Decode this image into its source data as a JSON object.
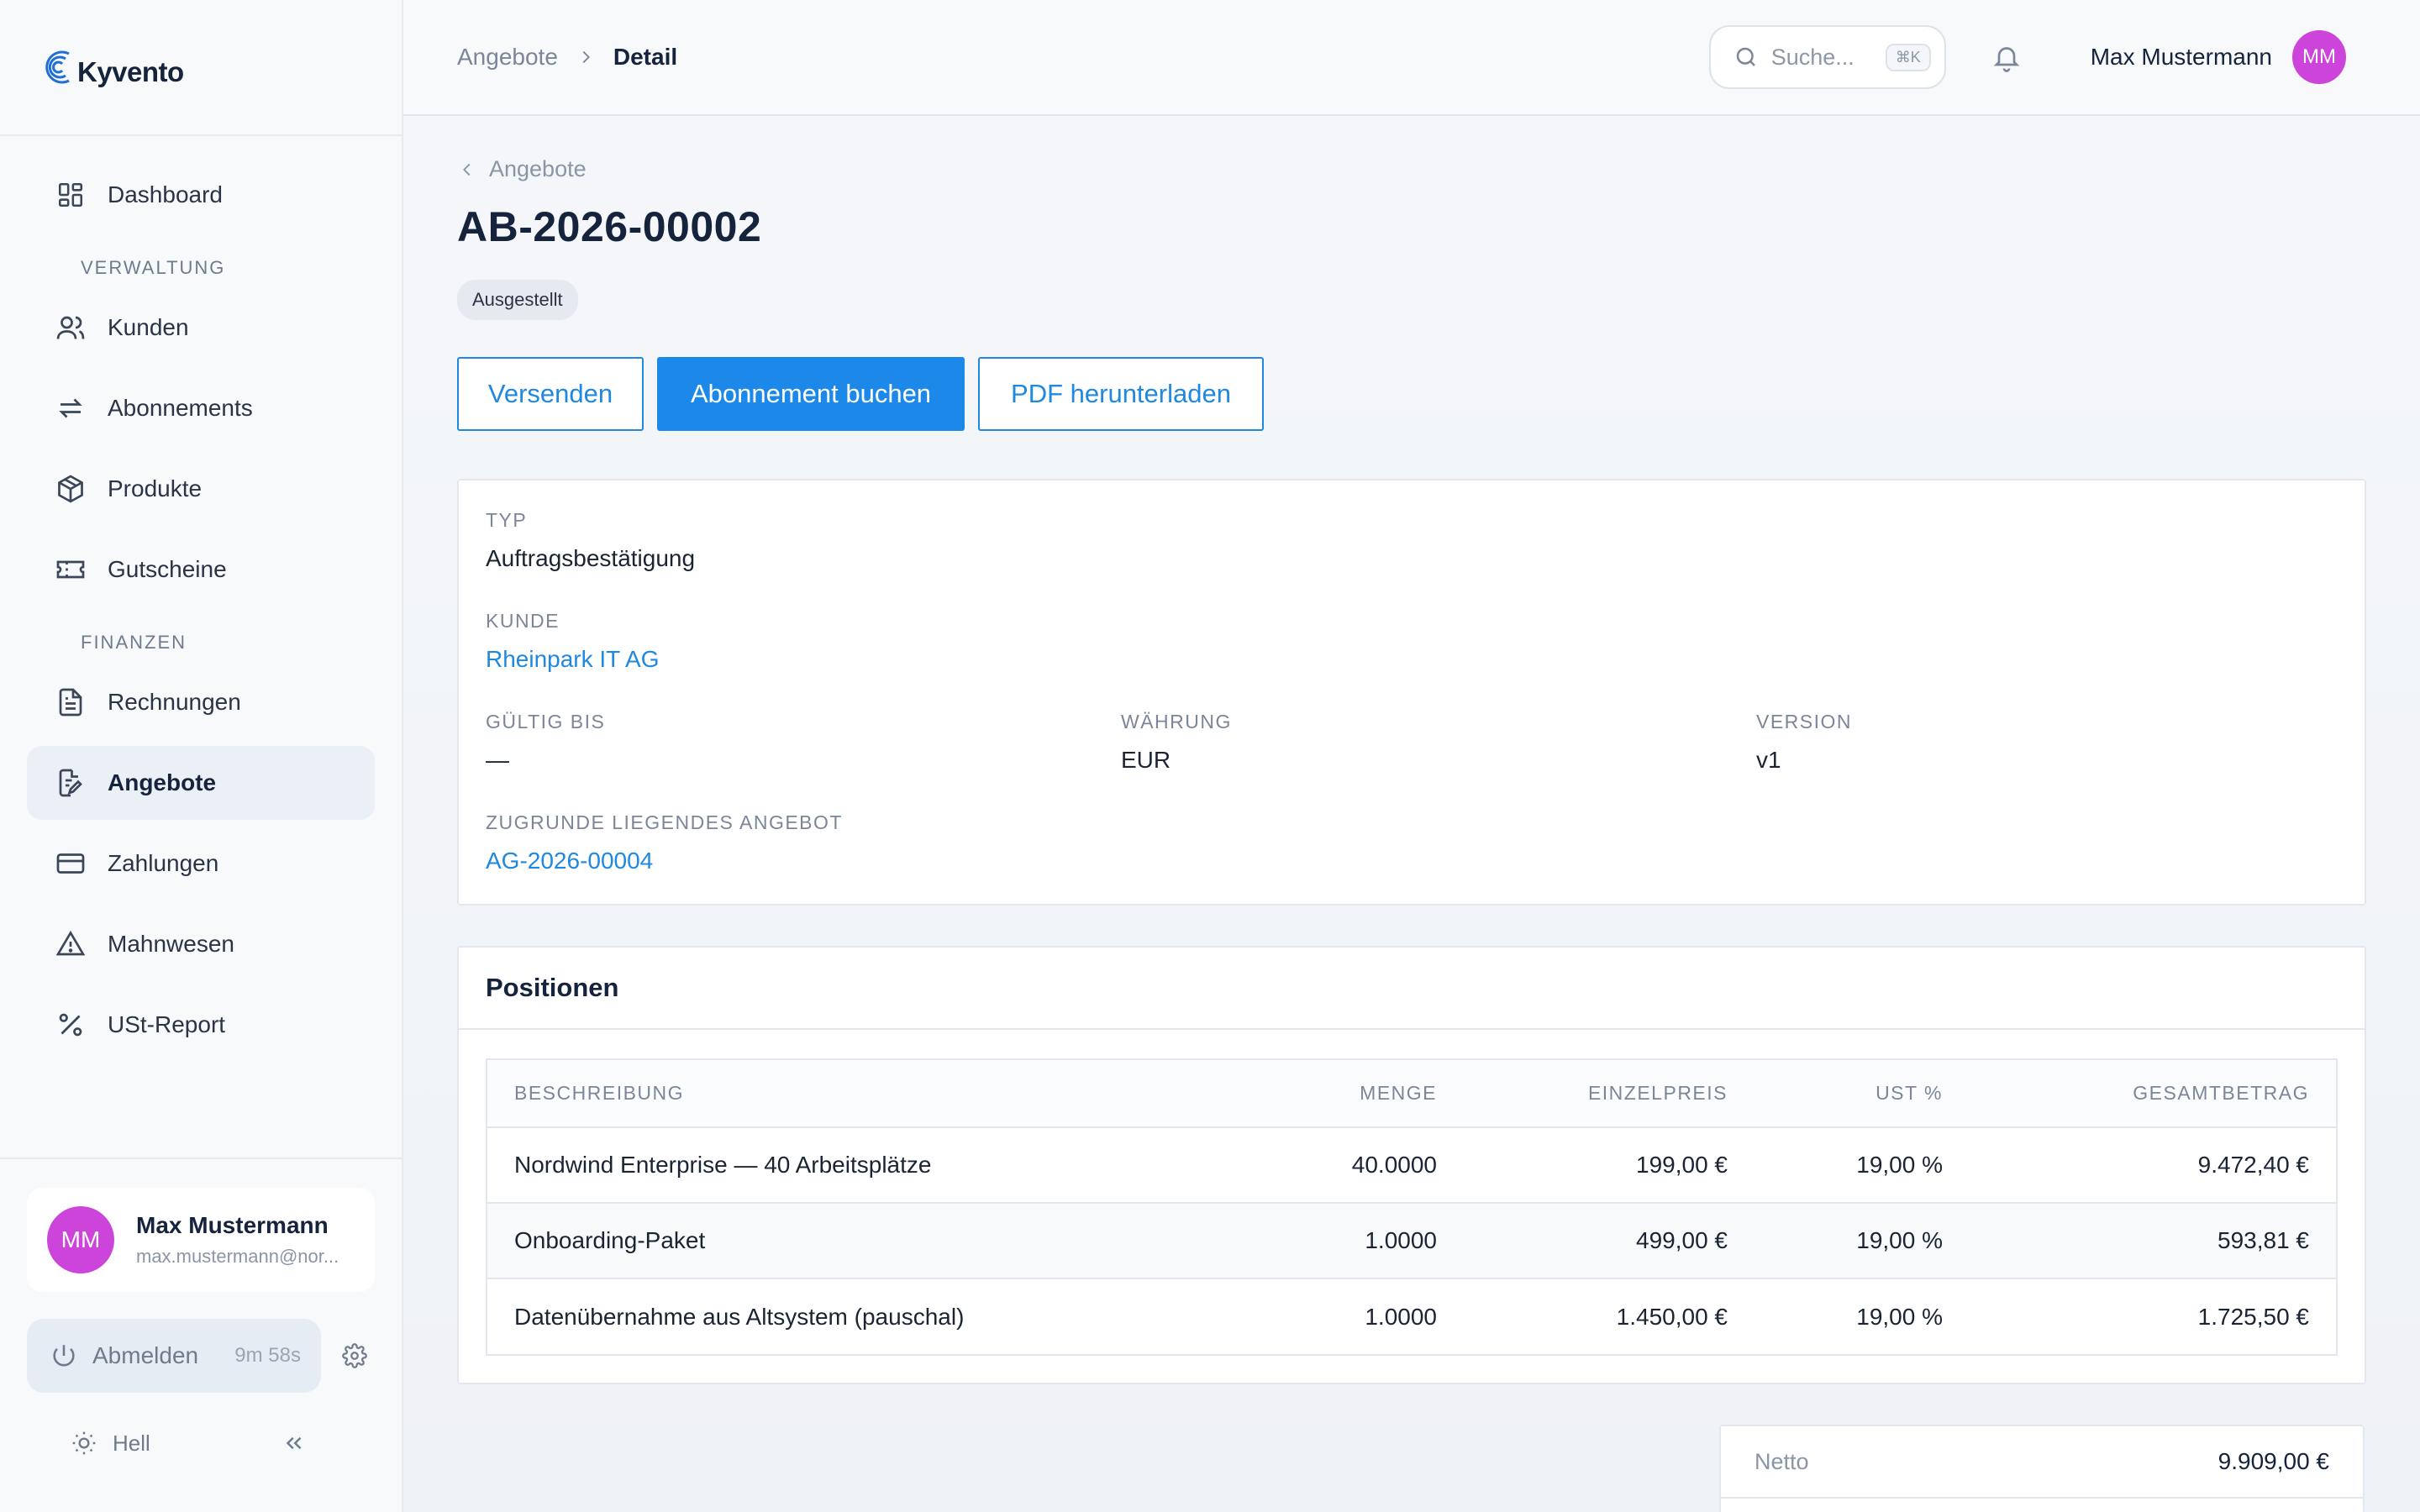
{
  "brand": {
    "name": "Kyvento",
    "accent": "#1c89ea"
  },
  "sidebar": {
    "nav_top": [
      {
        "label": "Dashboard",
        "icon": "dashboard-icon"
      }
    ],
    "sections": [
      {
        "title": "VERWALTUNG",
        "items": [
          {
            "label": "Kunden",
            "icon": "users-icon"
          },
          {
            "label": "Abonnements",
            "icon": "repeat-icon"
          },
          {
            "label": "Produkte",
            "icon": "package-icon"
          },
          {
            "label": "Gutscheine",
            "icon": "ticket-icon"
          }
        ]
      },
      {
        "title": "FINANZEN",
        "items": [
          {
            "label": "Rechnungen",
            "icon": "invoice-icon"
          },
          {
            "label": "Angebote",
            "icon": "quote-edit-icon",
            "active": true
          },
          {
            "label": "Zahlungen",
            "icon": "credit-card-icon"
          },
          {
            "label": "Mahnwesen",
            "icon": "warning-icon"
          },
          {
            "label": "USt-Report",
            "icon": "percent-icon"
          }
        ]
      }
    ],
    "user": {
      "initials": "MM",
      "name": "Max Mustermann",
      "email": "max.mustermann@nor..."
    },
    "logout": {
      "label": "Abmelden",
      "timer": "9m 58s"
    },
    "theme": {
      "label": "Hell"
    }
  },
  "topbar": {
    "breadcrumb": {
      "parent": "Angebote",
      "current": "Detail"
    },
    "search": {
      "placeholder": "Suche...",
      "shortcut": "⌘K"
    },
    "user": {
      "name": "Max Mustermann",
      "initials": "MM",
      "avatar_color": "#cc44d9"
    }
  },
  "page": {
    "back_label": "Angebote",
    "title": "AB-2026-00002",
    "status": "Ausgestellt",
    "actions": {
      "send": "Versenden",
      "book": "Abonnement buchen",
      "pdf": "PDF herunterladen"
    }
  },
  "details": {
    "type_label": "TYP",
    "type_value": "Auftragsbestätigung",
    "customer_label": "KUNDE",
    "customer_value": "Rheinpark IT AG",
    "valid_label": "GÜLTIG BIS",
    "valid_value": "—",
    "currency_label": "WÄHRUNG",
    "currency_value": "EUR",
    "version_label": "VERSION",
    "version_value": "v1",
    "base_offer_label": "ZUGRUNDE LIEGENDES ANGEBOT",
    "base_offer_value": "AG-2026-00004"
  },
  "positions": {
    "title": "Positionen",
    "columns": {
      "description": "BESCHREIBUNG",
      "qty": "MENGE",
      "unit_price": "EINZELPREIS",
      "tax": "UST %",
      "total": "GESAMTBETRAG"
    },
    "rows": [
      {
        "description": "Nordwind Enterprise — 40 Arbeitsplätze",
        "qty": "40.0000",
        "unit_price": "199,00 €",
        "tax": "19,00 %",
        "total": "9.472,40 €"
      },
      {
        "description": "Onboarding-Paket",
        "qty": "1.0000",
        "unit_price": "499,00 €",
        "tax": "19,00 %",
        "total": "593,81 €"
      },
      {
        "description": "Datenübernahme aus Altsystem (pauschal)",
        "qty": "1.0000",
        "unit_price": "1.450,00 €",
        "tax": "19,00 %",
        "total": "1.725,50 €"
      }
    ]
  },
  "totals": {
    "net_label": "Netto",
    "net_value": "9.909,00 €"
  }
}
